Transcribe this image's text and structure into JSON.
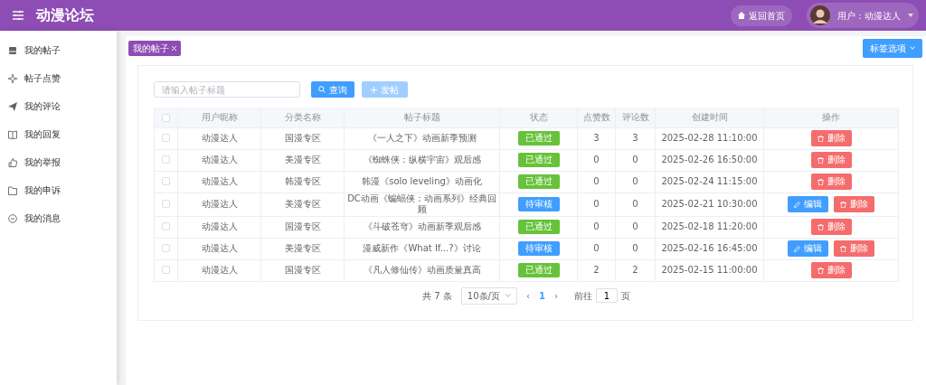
{
  "header": {
    "title": "动漫论坛",
    "home_button": "返回首页",
    "user_label": "用户：动漫达人"
  },
  "sidebar": {
    "items": [
      {
        "label": "我的帖子",
        "selected": false
      },
      {
        "label": "帖子点赞",
        "selected": false
      },
      {
        "label": "我的评论",
        "selected": false
      },
      {
        "label": "我的回复",
        "selected": false
      },
      {
        "label": "我的举报",
        "selected": false
      },
      {
        "label": "我的申诉",
        "selected": false
      },
      {
        "label": "我的消息",
        "selected": false
      }
    ]
  },
  "tags": [
    {
      "label": "我的帖子",
      "selected": true
    }
  ],
  "tag_options_button": "标签选项",
  "search": {
    "placeholder": "请输入帖子标题",
    "query_button": "查询",
    "post_button": "发帖"
  },
  "table": {
    "select_all_checked": false,
    "columns": [
      "用户昵称",
      "分类名称",
      "帖子标题",
      "状态",
      "点赞数",
      "评论数",
      "创建时间",
      "操作"
    ],
    "rows": [
      {
        "checked": false,
        "user": "动漫达人",
        "category": "国漫专区",
        "title": "《一人之下》动画新季预测",
        "status": {
          "label": "已通过",
          "color": "#67c23a"
        },
        "likes": "3",
        "comments": "3",
        "created": "2025-02-28 11:10:00",
        "actions": [
          {
            "label": "删除",
            "kind": "delete"
          }
        ]
      },
      {
        "checked": false,
        "user": "动漫达人",
        "category": "美漫专区",
        "title": "《蜘蛛侠：纵横宇宙》观后感",
        "status": {
          "label": "已通过",
          "color": "#67c23a"
        },
        "likes": "0",
        "comments": "0",
        "created": "2025-02-26 16:50:00",
        "actions": [
          {
            "label": "删除",
            "kind": "delete"
          }
        ]
      },
      {
        "checked": false,
        "user": "动漫达人",
        "category": "韩漫专区",
        "title": "韩漫《solo leveling》动画化",
        "status": {
          "label": "已通过",
          "color": "#67c23a"
        },
        "likes": "0",
        "comments": "0",
        "created": "2025-02-24 11:15:00",
        "actions": [
          {
            "label": "删除",
            "kind": "delete"
          }
        ]
      },
      {
        "checked": false,
        "user": "动漫达人",
        "category": "美漫专区",
        "title": "DC动画《蝙蝠侠：动画系列》经典回顾",
        "status": {
          "label": "待审核",
          "color": "#409eff"
        },
        "likes": "0",
        "comments": "0",
        "created": "2025-02-21 10:30:00",
        "actions": [
          {
            "label": "编辑",
            "kind": "edit"
          },
          {
            "label": "删除",
            "kind": "delete"
          }
        ]
      },
      {
        "checked": false,
        "user": "动漫达人",
        "category": "国漫专区",
        "title": "《斗破苍穹》动画新季观后感",
        "status": {
          "label": "已通过",
          "color": "#67c23a"
        },
        "likes": "0",
        "comments": "0",
        "created": "2025-02-18 11:20:00",
        "actions": [
          {
            "label": "删除",
            "kind": "delete"
          }
        ]
      },
      {
        "checked": false,
        "user": "动漫达人",
        "category": "美漫专区",
        "title": "漫威新作《What If...?》讨论",
        "status": {
          "label": "待审核",
          "color": "#409eff"
        },
        "likes": "0",
        "comments": "0",
        "created": "2025-02-16 16:45:00",
        "actions": [
          {
            "label": "编辑",
            "kind": "edit"
          },
          {
            "label": "删除",
            "kind": "delete"
          }
        ]
      },
      {
        "checked": false,
        "user": "动漫达人",
        "category": "国漫专区",
        "title": "《凡人修仙传》动画质量真高",
        "status": {
          "label": "已通过",
          "color": "#67c23a"
        },
        "likes": "2",
        "comments": "2",
        "created": "2025-02-15 11:00:00",
        "actions": [
          {
            "label": "删除",
            "kind": "delete"
          }
        ]
      }
    ]
  },
  "pagination": {
    "total": "共 7 条",
    "page_size": "10条/页",
    "prev": "‹",
    "pages": [
      {
        "label": "1",
        "selected": true
      }
    ],
    "next": "›",
    "goto_label": "前往",
    "goto_value": "1",
    "goto_suffix": "页"
  }
}
